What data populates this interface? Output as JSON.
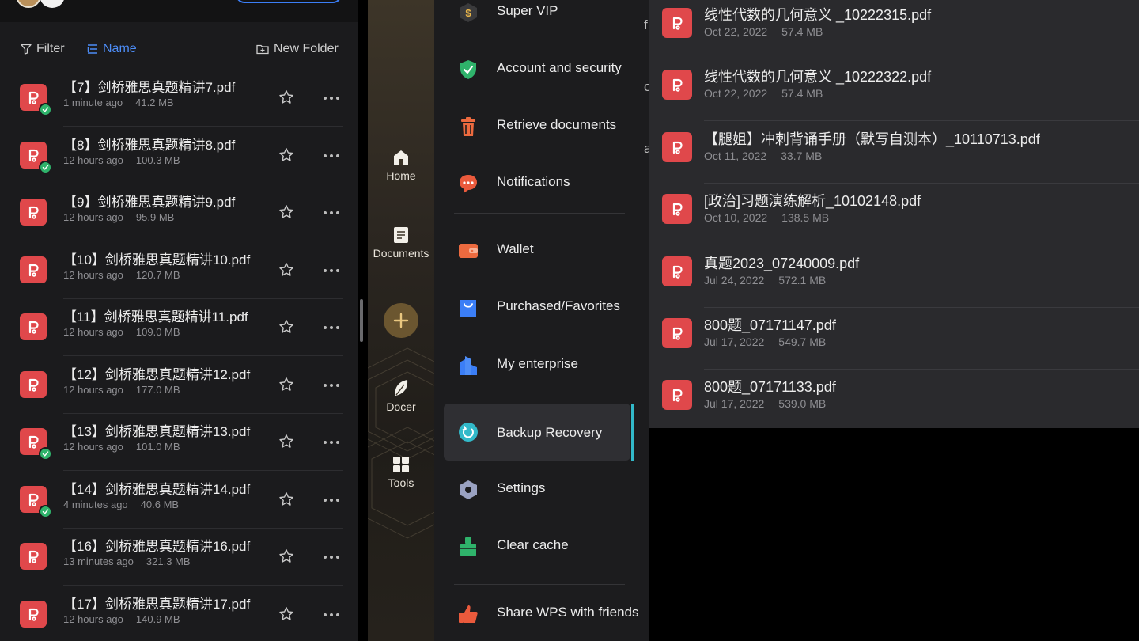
{
  "colors": {
    "accent_blue": "#4d8df7",
    "pdf_red": "#e0484b",
    "sync_green": "#2fb36b",
    "active_bar": "#32b9c9"
  },
  "toolbar": {
    "filter_label": "Filter",
    "sort_label": "Name",
    "new_folder_label": "New Folder"
  },
  "files": [
    {
      "name": "【7】剑桥雅思真题精讲7.pdf",
      "time": "1 minute ago",
      "size": "41.2 MB",
      "synced": true
    },
    {
      "name": "【8】剑桥雅思真题精讲8.pdf",
      "time": "12 hours ago",
      "size": "100.3 MB",
      "synced": true
    },
    {
      "name": "【9】剑桥雅思真题精讲9.pdf",
      "time": "12 hours ago",
      "size": "95.9 MB",
      "synced": false
    },
    {
      "name": "【10】剑桥雅思真题精讲10.pdf",
      "time": "12 hours ago",
      "size": "120.7 MB",
      "synced": false
    },
    {
      "name": "【11】剑桥雅思真题精讲11.pdf",
      "time": "12 hours ago",
      "size": "109.0 MB",
      "synced": false
    },
    {
      "name": "【12】剑桥雅思真题精讲12.pdf",
      "time": "12 hours ago",
      "size": "177.0 MB",
      "synced": false
    },
    {
      "name": "【13】剑桥雅思真题精讲13.pdf",
      "time": "12 hours ago",
      "size": "101.0 MB",
      "synced": true
    },
    {
      "name": "【14】剑桥雅思真题精讲14.pdf",
      "time": "4 minutes ago",
      "size": "40.6 MB",
      "synced": true
    },
    {
      "name": "【16】剑桥雅思真题精讲16.pdf",
      "time": "13 minutes ago",
      "size": "321.3 MB",
      "synced": false
    },
    {
      "name": "【17】剑桥雅思真题精讲17.pdf",
      "time": "12 hours ago",
      "size": "140.9 MB",
      "synced": false
    }
  ],
  "rail": {
    "home": "Home",
    "documents": "Documents",
    "docer": "Docer",
    "tools": "Tools"
  },
  "menu": {
    "super_vip": "Super VIP",
    "account_security": "Account and security",
    "retrieve_documents": "Retrieve documents",
    "notifications": "Notifications",
    "wallet": "Wallet",
    "purchased_favorites": "Purchased/Favorites",
    "my_enterprise": "My enterprise",
    "backup_recovery": "Backup Recovery",
    "settings": "Settings",
    "clear_cache": "Clear cache",
    "share_wps": "Share WPS with friends"
  },
  "recent": [
    {
      "name": "线性代数的几何意义 _10222315.pdf",
      "date": "Oct 22, 2022",
      "size": "57.4 MB"
    },
    {
      "name": "线性代数的几何意义 _10222322.pdf",
      "date": "Oct 22, 2022",
      "size": "57.4 MB"
    },
    {
      "name": "【腿姐】冲刺背诵手册（默写自测本）_10110713.pdf",
      "date": "Oct 11, 2022",
      "size": "33.7 MB"
    },
    {
      "name": "[政治]习题演练解析_10102148.pdf",
      "date": "Oct 10, 2022",
      "size": "138.5 MB"
    },
    {
      "name": "真题2023_07240009.pdf",
      "date": "Jul 24, 2022",
      "size": "572.1 MB"
    },
    {
      "name": "800题_07171147.pdf",
      "date": "Jul 17, 2022",
      "size": "549.7 MB"
    },
    {
      "name": "800题_07171133.pdf",
      "date": "Jul 17, 2022",
      "size": "539.0 MB"
    }
  ]
}
